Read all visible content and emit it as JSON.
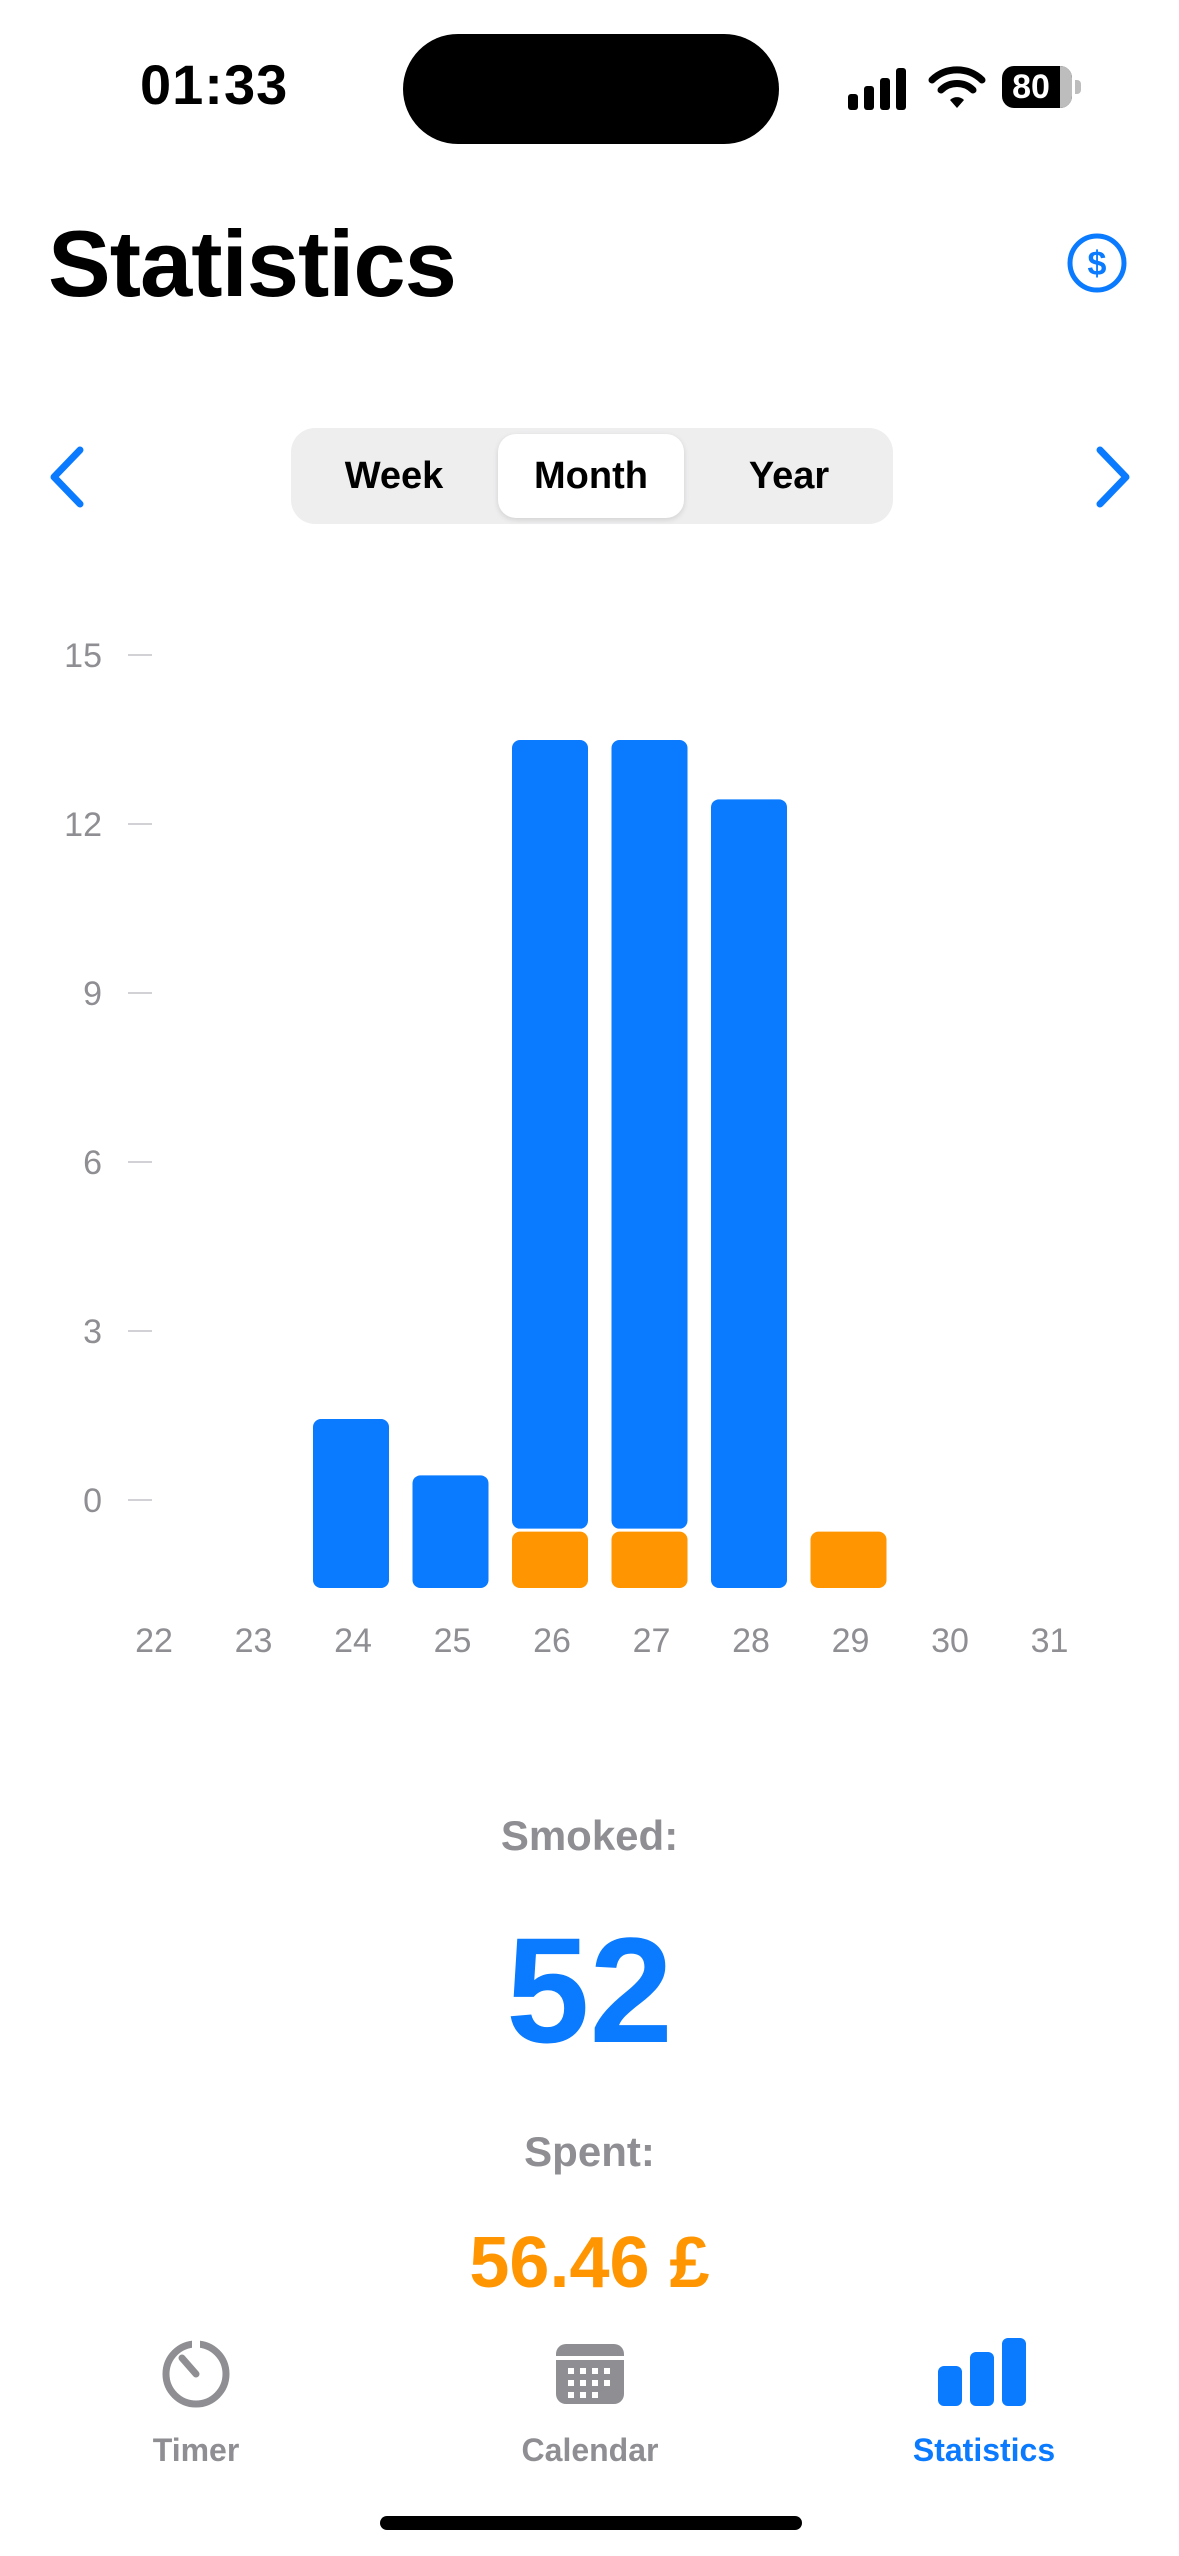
{
  "status_bar": {
    "time": "01:33",
    "battery": "80"
  },
  "header": {
    "title": "Statistics",
    "action_icon": "dollar-circle-icon"
  },
  "segmented": {
    "options": [
      "Week",
      "Month",
      "Year"
    ],
    "selected": "Month"
  },
  "chart_data": {
    "type": "bar",
    "stacked": true,
    "x_tick_labels": [
      "22",
      "23",
      "24",
      "25",
      "26",
      "27",
      "28",
      "29",
      "30",
      "31"
    ],
    "categories": [
      "23",
      "24",
      "25",
      "26",
      "27",
      "28",
      "29",
      "30",
      "31"
    ],
    "series": [
      {
        "color": "#0a7aff",
        "values": [
          0,
          3,
          2,
          14,
          14,
          14,
          0,
          0,
          0
        ]
      },
      {
        "color": "#ff9500",
        "values": [
          0,
          0,
          0,
          1,
          1,
          0,
          1,
          0,
          0
        ]
      }
    ],
    "y_ticks": [
      "15",
      "12",
      "9",
      "6",
      "3",
      "0"
    ],
    "ylim": [
      0,
      15
    ],
    "grid": false
  },
  "stats": {
    "smoked_label": "Smoked:",
    "smoked_value": "52",
    "spent_label": "Spent:",
    "spent_value": "56.46 £"
  },
  "tabbar": {
    "items": [
      {
        "label": "Timer",
        "icon": "timer-icon",
        "active": false
      },
      {
        "label": "Calendar",
        "icon": "calendar-icon",
        "active": false
      },
      {
        "label": "Statistics",
        "icon": "bar-chart-icon",
        "active": true
      }
    ]
  }
}
